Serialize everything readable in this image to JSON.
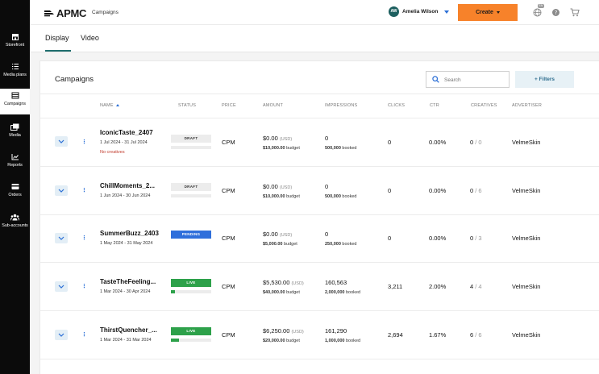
{
  "sidebar": {
    "items": [
      {
        "label": "Storefront",
        "icon": "storefront-icon",
        "active": false
      },
      {
        "label": "Media plans",
        "icon": "media-plans-icon",
        "active": false
      },
      {
        "label": "Campaigns",
        "icon": "campaigns-icon",
        "active": true
      },
      {
        "label": "Media",
        "icon": "media-icon",
        "active": false
      },
      {
        "label": "Reports",
        "icon": "reports-icon",
        "active": false
      },
      {
        "label": "Orders",
        "icon": "orders-icon",
        "active": false
      },
      {
        "label": "Sub-accounts",
        "icon": "sub-accounts-icon",
        "active": false
      }
    ]
  },
  "header": {
    "logo": "APMC",
    "breadcrumb": "Campaigns",
    "user_initials": "AW",
    "user_name": "Amelia Wilson",
    "create_label": "Create",
    "lang_badge": "EN"
  },
  "tabs": [
    {
      "label": "Display",
      "active": true
    },
    {
      "label": "Video",
      "active": false
    }
  ],
  "panel": {
    "title": "Campaigns",
    "search_placeholder": "Search",
    "filters_label": "+ Filters"
  },
  "table": {
    "columns": {
      "name": "NAME",
      "status": "STATUS",
      "price": "PRICE",
      "amount": "AMOUNT",
      "impressions": "IMPRESSIONS",
      "clicks": "CLICKS",
      "ctr": "CTR",
      "creatives": "CREATIVES",
      "advertiser": "ADVERTISER"
    },
    "rows": [
      {
        "name": "IconicTaste_2407",
        "dates": "1 Jul 2024 - 31 Jul 2024",
        "warning": "No creatives",
        "status": "DRAFT",
        "progress": 0,
        "price": "CPM",
        "amount": "$0.00",
        "amount_currency": "(USD)",
        "budget": "$10,000.00",
        "budget_label": "budget",
        "impressions": "0",
        "booked": "500,000",
        "booked_label": "booked",
        "clicks": "0",
        "ctr": "0.00%",
        "creatives_active": "0",
        "creatives_total": "/ 0",
        "advertiser": "VelmeSkin"
      },
      {
        "name": "ChillMoments_2...",
        "dates": "1 Jun 2024 - 30 Jun 2024",
        "warning": "",
        "status": "DRAFT",
        "progress": 0,
        "price": "CPM",
        "amount": "$0.00",
        "amount_currency": "(USD)",
        "budget": "$10,000.00",
        "budget_label": "budget",
        "impressions": "0",
        "booked": "500,000",
        "booked_label": "booked",
        "clicks": "0",
        "ctr": "0.00%",
        "creatives_active": "0",
        "creatives_total": "/ 6",
        "advertiser": "VelmeSkin"
      },
      {
        "name": "SummerBuzz_2403",
        "dates": "1 May 2024 - 31 May 2024",
        "warning": "",
        "status": "PENDING",
        "progress": 0,
        "price": "CPM",
        "amount": "$0.00",
        "amount_currency": "(USD)",
        "budget": "$5,000.00",
        "budget_label": "budget",
        "impressions": "0",
        "booked": "250,000",
        "booked_label": "booked",
        "clicks": "0",
        "ctr": "0.00%",
        "creatives_active": "0",
        "creatives_total": "/ 3",
        "advertiser": "VelmeSkin"
      },
      {
        "name": "TasteTheFeeling...",
        "dates": "1 Mar 2024 - 30 Apr 2024",
        "warning": "",
        "status": "LIVE",
        "progress": 0.1,
        "price": "CPM",
        "amount": "$5,530.00",
        "amount_currency": "(USD)",
        "budget": "$40,000.00",
        "budget_label": "budget",
        "impressions": "160,563",
        "booked": "2,000,000",
        "booked_label": "booked",
        "clicks": "3,211",
        "ctr": "2.00%",
        "creatives_active": "4",
        "creatives_total": "/ 4",
        "advertiser": "VelmeSkin"
      },
      {
        "name": "ThirstQuencher_...",
        "dates": "1 Mar 2024 - 31 Mar 2024",
        "warning": "",
        "status": "LIVE",
        "progress": 0.2,
        "price": "CPM",
        "amount": "$6,250.00",
        "amount_currency": "(USD)",
        "budget": "$20,000.00",
        "budget_label": "budget",
        "impressions": "161,290",
        "booked": "1,000,000",
        "booked_label": "booked",
        "clicks": "2,694",
        "ctr": "1.67%",
        "creatives_active": "6",
        "creatives_total": "/ 6",
        "advertiser": "VelmeSkin"
      }
    ]
  },
  "colors": {
    "accent_orange": "#f7822a",
    "teal": "#1f6e6e",
    "live_green": "#2da14a",
    "pending_blue": "#2f6fdb",
    "link_blue": "#2b6fd6"
  }
}
